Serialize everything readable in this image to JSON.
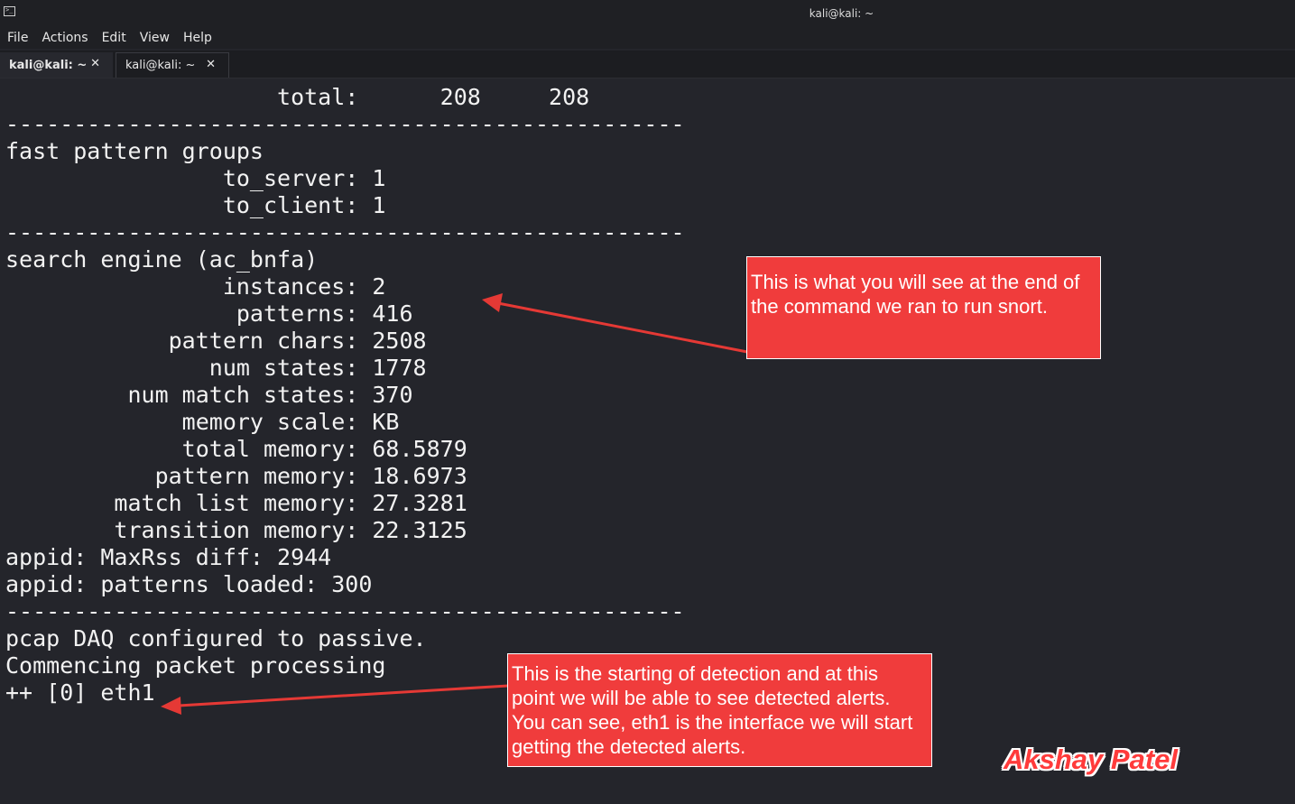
{
  "window": {
    "title": "kali@kali: ~"
  },
  "menu": [
    "File",
    "Actions",
    "Edit",
    "View",
    "Help"
  ],
  "tabs": [
    {
      "label": "kali@kali: ~",
      "active": true
    },
    {
      "label": "kali@kali: ~",
      "active": false
    }
  ],
  "terminal": {
    "lines": [
      "                    total:      208     208",
      "--------------------------------------------------",
      "fast pattern groups",
      "                to_server: 1",
      "                to_client: 1",
      "--------------------------------------------------",
      "search engine (ac_bnfa)",
      "                instances: 2",
      "                 patterns: 416",
      "            pattern chars: 2508",
      "               num states: 1778",
      "         num match states: 370",
      "             memory scale: KB",
      "             total memory: 68.5879",
      "           pattern memory: 18.6973",
      "        match list memory: 27.3281",
      "        transition memory: 22.3125",
      "appid: MaxRss diff: 2944",
      "appid: patterns loaded: 300",
      "--------------------------------------------------",
      "pcap DAQ configured to passive.",
      "Commencing packet processing",
      "++ [0] eth1"
    ]
  },
  "annotations": {
    "top": "This is what you will see at the end of the command we ran to run snort.",
    "bottom": "This is the starting of detection and at this point we will be able to see detected alerts. You can see, eth1 is the interface we will start getting the detected alerts."
  },
  "signature": "Akshay Patel",
  "colors": {
    "background": "#24252b",
    "callout": "#f03c3c",
    "arrow": "#e53935"
  }
}
